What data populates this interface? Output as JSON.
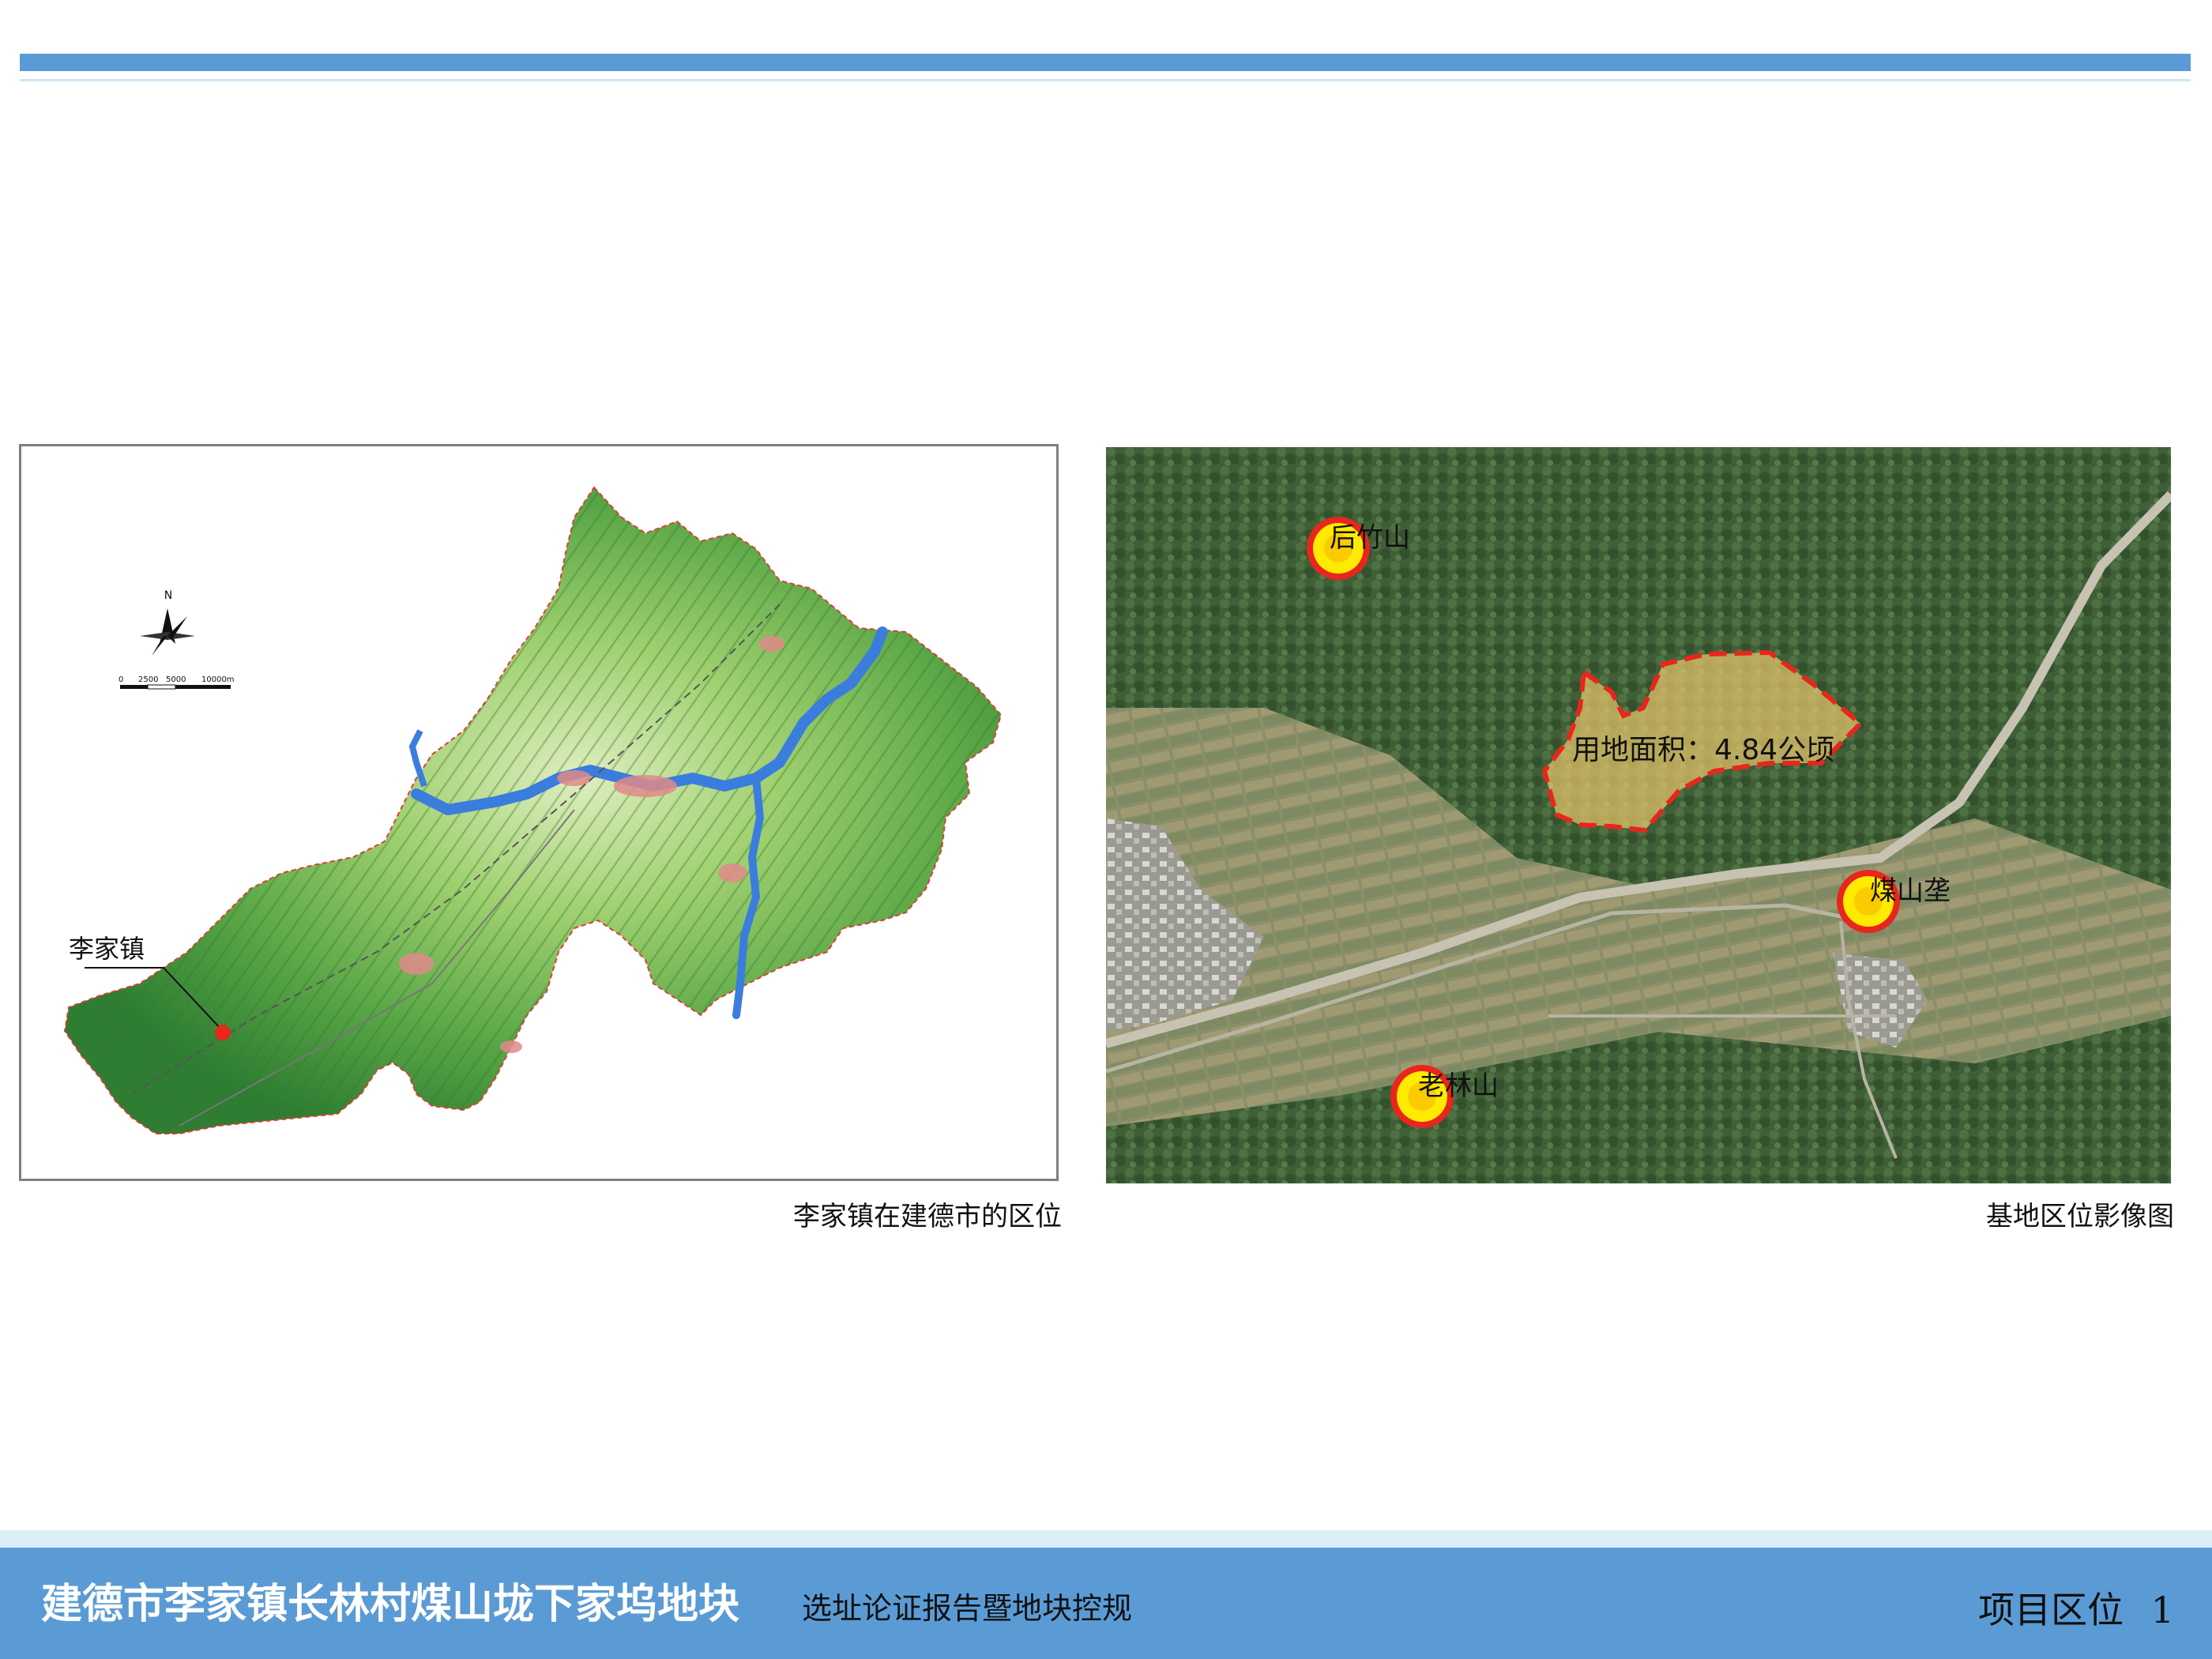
{
  "left_map": {
    "town_label": "李家镇",
    "north_label": "N",
    "scale_ticks": [
      "0",
      "2500",
      "5000",
      "10000m"
    ],
    "caption": "李家镇在建德市的区位"
  },
  "right_map": {
    "area_label": "用地面积：4.84公顷",
    "places": [
      "后竹山",
      "煤山垄",
      "老林山"
    ],
    "caption": "基地区位影像图"
  },
  "footer": {
    "title": "建德市李家镇长林村煤山垅下家坞地块",
    "subtitle": "选址论证报告暨地块控规",
    "section": "项目区位",
    "page_number": "1"
  },
  "colors": {
    "accent": "#5b9bd5",
    "marker_red": "#e8261c",
    "marker_yellow": "#ffea00",
    "site_fill": "#e6c56b"
  }
}
